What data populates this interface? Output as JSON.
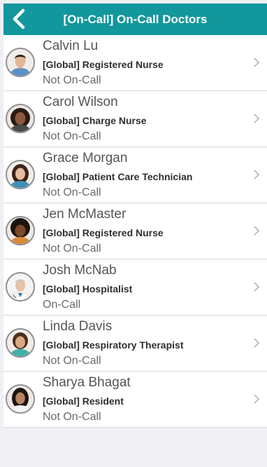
{
  "header": {
    "title": "[On-Call] On-Call Doctors",
    "background_color": "#12979c",
    "back_icon": "chevron-left-icon"
  },
  "contacts": [
    {
      "name": "Calvin Lu",
      "role": "[Global] Registered Nurse",
      "status": "Not On-Call"
    },
    {
      "name": "Carol Wilson",
      "role": "[Global] Charge Nurse",
      "status": "Not On-Call"
    },
    {
      "name": "Grace Morgan",
      "role": "[Global] Patient Care Technician",
      "status": "Not On-Call"
    },
    {
      "name": "Jen McMaster",
      "role": "[Global] Registered Nurse",
      "status": "Not On-Call"
    },
    {
      "name": "Josh McNab",
      "role": "[Global] Hospitalist",
      "status": "On-Call"
    },
    {
      "name": "Linda Davis",
      "role": "[Global] Respiratory Therapist",
      "status": "Not On-Call"
    },
    {
      "name": "Sharya Bhagat",
      "role": "[Global] Resident",
      "status": "Not On-Call"
    }
  ],
  "row_chevron_icon": "chevron-right-icon"
}
